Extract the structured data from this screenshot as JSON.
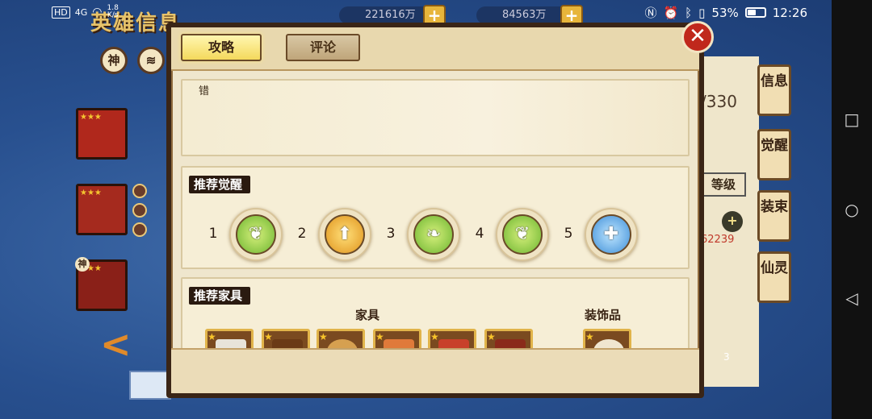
{
  "status_bar": {
    "network": "HD",
    "signal": "4G",
    "speed_value": "1.8",
    "speed_unit": "K/s",
    "battery_percent": "53%",
    "time": "12:26",
    "battery_level": 0.53
  },
  "background": {
    "title_fragment": "英雄信息",
    "resource_1": "221616万",
    "resource_2": "84563万",
    "plus_label": "+",
    "filter_god": "神",
    "back_arrow": "<",
    "left_arrow": "<",
    "side_count": "/330",
    "side_grade": "等级",
    "side_value": "62239",
    "side_tabs": [
      "信息",
      "觉醒",
      "装束",
      "仙灵"
    ],
    "slot_tag": "神",
    "bottom_count": "3"
  },
  "dialog": {
    "tabs": [
      {
        "label": "攻略",
        "active": true
      },
      {
        "label": "评论",
        "active": false
      }
    ],
    "close_label": "✕",
    "intro_text": "错",
    "awakening": {
      "title": "推荐觉醒",
      "skills": [
        {
          "num": "1",
          "icon": "leaf-sprout-icon",
          "color": "green"
        },
        {
          "num": "2",
          "icon": "shield-arrow-icon",
          "color": "orange"
        },
        {
          "num": "3",
          "icon": "vine-leaf-icon",
          "color": "green"
        },
        {
          "num": "4",
          "icon": "leaf-sprout-icon",
          "color": "green"
        },
        {
          "num": "5",
          "icon": "blue-cross-icon",
          "color": "blue"
        }
      ]
    },
    "furniture": {
      "title": "推荐家具",
      "furniture_label": "家具",
      "decoration_label": "装饰品",
      "items": [
        {
          "icon": "screen-panel-icon"
        },
        {
          "icon": "wood-table-icon"
        },
        {
          "icon": "round-window-icon"
        },
        {
          "icon": "bed-icon"
        },
        {
          "icon": "red-desk-icon"
        },
        {
          "icon": "treasure-shelf-icon"
        }
      ],
      "decorations": [
        {
          "icon": "flower-mirror-icon"
        }
      ]
    }
  }
}
